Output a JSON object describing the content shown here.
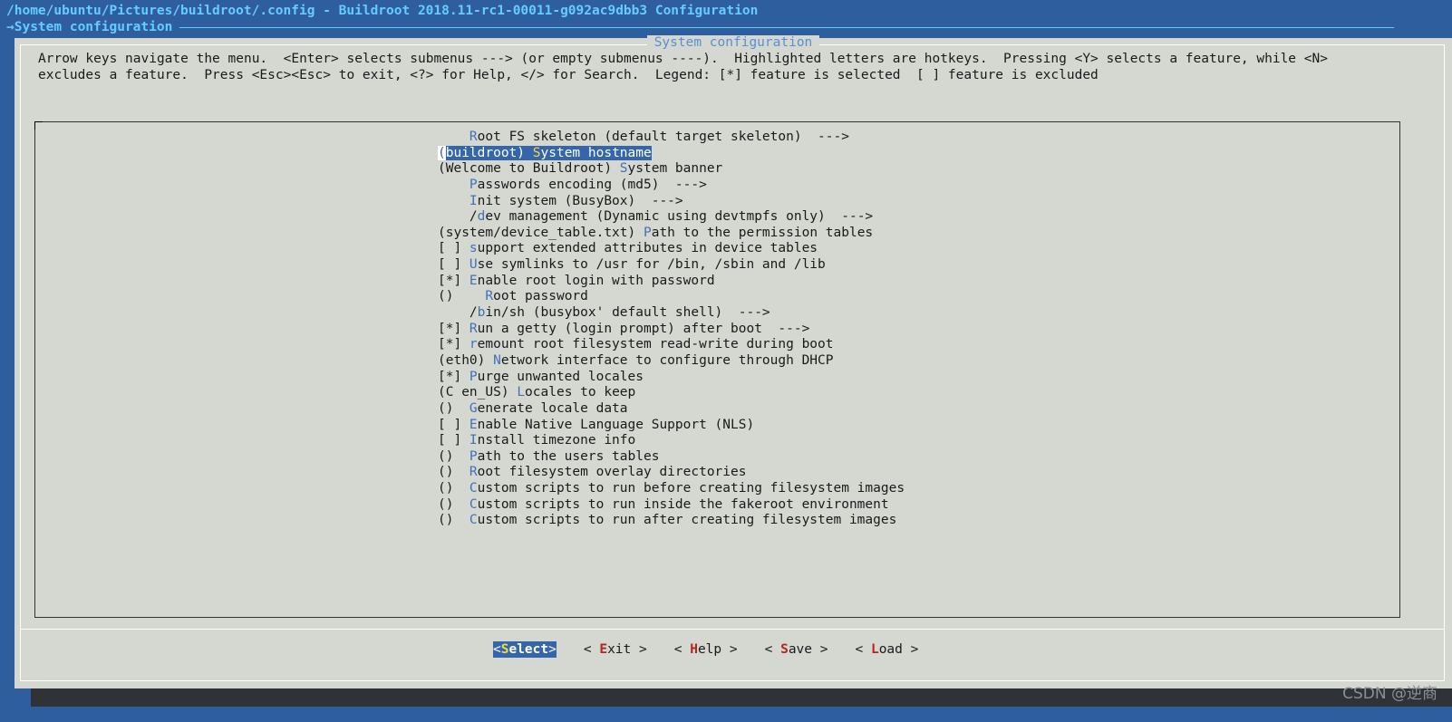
{
  "window": {
    "title": "/home/ubuntu/Pictures/buildroot/.config - Buildroot 2018.11-rc1-00011-g092ac9dbb3 Configuration",
    "breadcrumb_arrow": "→",
    "breadcrumb": "System configuration"
  },
  "dialog": {
    "title": "System configuration",
    "help_line1": "Arrow keys navigate the menu.  <Enter> selects submenus ---> (or empty submenus ----).  Highlighted letters are hotkeys.  Pressing <Y> selects a feature, while <N>",
    "help_line2": "excludes a feature.  Press <Esc><Esc> to exit, <?> for Help, </> for Search.  Legend: [*] feature is selected  [ ] feature is excluded"
  },
  "menu": [
    {
      "pre": "    ",
      "hot": "R",
      "rest": "oot FS skeleton (default target skeleton)  --->"
    },
    {
      "pre": "(buildroot) ",
      "hot": "S",
      "rest": "ystem hostname",
      "selected": true
    },
    {
      "pre": "(Welcome to Buildroot) ",
      "hot": "S",
      "rest": "ystem banner"
    },
    {
      "pre": "    ",
      "hot": "P",
      "rest": "asswords encoding (md5)  --->"
    },
    {
      "pre": "    ",
      "hot": "I",
      "rest": "nit system (BusyBox)  --->"
    },
    {
      "pre": "    /",
      "hot": "d",
      "rest": "ev management (Dynamic using devtmpfs only)  --->"
    },
    {
      "pre": "(system/device_table.txt) ",
      "hot": "P",
      "rest": "ath to the permission tables"
    },
    {
      "pre": "[ ] ",
      "hot": "s",
      "rest": "upport extended attributes in device tables"
    },
    {
      "pre": "[ ] ",
      "hot": "U",
      "rest": "se symlinks to /usr for /bin, /sbin and /lib"
    },
    {
      "pre": "[*] ",
      "hot": "E",
      "rest": "nable root login with password"
    },
    {
      "pre": "()    ",
      "hot": "R",
      "rest": "oot password"
    },
    {
      "pre": "    /",
      "hot": "b",
      "rest": "in/sh (busybox' default shell)  --->"
    },
    {
      "pre": "[*] ",
      "hot": "R",
      "rest": "un a getty (login prompt) after boot  --->"
    },
    {
      "pre": "[*] ",
      "hot": "r",
      "rest": "emount root filesystem read-write during boot"
    },
    {
      "pre": "(eth0) ",
      "hot": "N",
      "rest": "etwork interface to configure through DHCP"
    },
    {
      "pre": "[*] ",
      "hot": "P",
      "rest": "urge unwanted locales"
    },
    {
      "pre": "(C en_US) ",
      "hot": "L",
      "rest": "ocales to keep"
    },
    {
      "pre": "()  ",
      "hot": "G",
      "rest": "enerate locale data"
    },
    {
      "pre": "[ ] ",
      "hot": "E",
      "rest": "nable Native Language Support (NLS)"
    },
    {
      "pre": "[ ] ",
      "hot": "I",
      "rest": "nstall timezone info"
    },
    {
      "pre": "()  ",
      "hot": "P",
      "rest": "ath to the users tables"
    },
    {
      "pre": "()  ",
      "hot": "R",
      "rest": "oot filesystem overlay directories"
    },
    {
      "pre": "()  ",
      "hot": "C",
      "rest": "ustom scripts to run before creating filesystem images"
    },
    {
      "pre": "()  ",
      "hot": "C",
      "rest": "ustom scripts to run inside the fakeroot environment"
    },
    {
      "pre": "()  ",
      "hot": "C",
      "rest": "ustom scripts to run after creating filesystem images"
    }
  ],
  "buttons": [
    {
      "name": "select",
      "open": "<",
      "hot": "S",
      "rest": "elect",
      "close": ">",
      "active": true
    },
    {
      "name": "exit",
      "open": "< ",
      "hot": "E",
      "rest": "xit",
      "close": " >"
    },
    {
      "name": "help",
      "open": "< ",
      "hot": "H",
      "rest": "elp",
      "close": " >"
    },
    {
      "name": "save",
      "open": "< ",
      "hot": "S",
      "rest": "ave",
      "close": " >"
    },
    {
      "name": "load",
      "open": "< ",
      "hot": "L",
      "rest": "oad",
      "close": " >"
    }
  ],
  "watermark": "CSDN @逆商",
  "colors": {
    "background": "#2f5e9e",
    "dialog": "#d5d7d1",
    "highlight": "#3466a9",
    "hotkey": "#3f72b8",
    "button_hotkey": "#b3261e",
    "title_text": "#66ccff"
  }
}
